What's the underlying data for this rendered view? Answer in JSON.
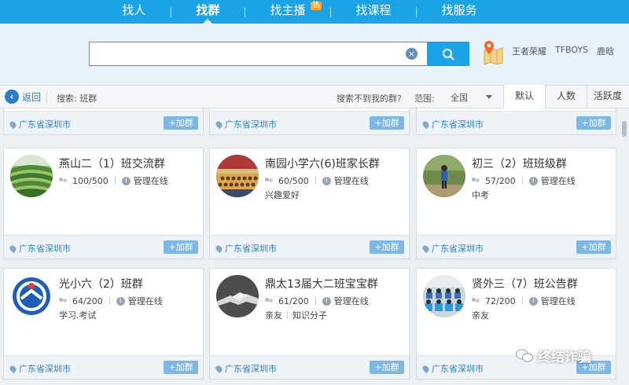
{
  "topnav": {
    "tabs": [
      {
        "label": "找人"
      },
      {
        "label": "找群"
      },
      {
        "label": "找主播",
        "badge": "热"
      },
      {
        "label": "找课程"
      },
      {
        "label": "找服务"
      }
    ],
    "active_index": 1,
    "separator": "|",
    "color": "#1aa3e6"
  },
  "search": {
    "query": "",
    "clear_symbol": "×",
    "hot_tags": [
      "王者荣耀",
      "TFBOYS",
      "鹿晗"
    ]
  },
  "toolbar": {
    "back_label": "返回",
    "search_label": "搜索: 班群",
    "not_found_label": "搜索不到我的群?",
    "range_label": "范围:",
    "range_value": "全国",
    "sort_tabs": [
      "默认",
      "人数",
      "活跃度"
    ],
    "active_sort_index": 0
  },
  "results": {
    "partial_row": [
      {
        "location": "广东省深圳市",
        "join_label": "+加群"
      },
      {
        "location": "广东省深圳市",
        "join_label": "+加群"
      },
      {
        "location": "广东省深圳市",
        "join_label": "+加群"
      }
    ],
    "cards": [
      {
        "name": "燕山二（1）班交流群",
        "members": "100/500",
        "admin_status": "管理在线",
        "tags": [],
        "location": "广东省深圳市",
        "join_label": "+加群",
        "avatar": "tea-field"
      },
      {
        "name": "南园小学六(6)班家长群",
        "members": "60/500",
        "admin_status": "管理在线",
        "tags": [
          "兴趣爱好"
        ],
        "location": "广东省深圳市",
        "join_label": "+加群",
        "avatar": "class-photo"
      },
      {
        "name": "初三（2）班班级群",
        "members": "57/200",
        "admin_status": "管理在线",
        "tags": [
          "中考"
        ],
        "location": "广东省深圳市",
        "join_label": "+加群",
        "avatar": "kid-outdoor"
      },
      {
        "name": "光小六（2）班群",
        "members": "64/200",
        "admin_status": "管理在线",
        "tags": [
          "学习.考试"
        ],
        "location": "广东省深圳市",
        "join_label": "+加群",
        "avatar": "school-logo"
      },
      {
        "name": "鼎太13届大二班宝宝群",
        "members": "61/200",
        "admin_status": "管理在线",
        "tags": [
          "亲友",
          "知识分子"
        ],
        "location": "广东省深圳市",
        "join_label": "+加群",
        "avatar": "handshake"
      },
      {
        "name": "贤外三（7）班公告群",
        "members": "72/200",
        "admin_status": "管理在线",
        "tags": [
          "亲友"
        ],
        "location": "广东省深圳市",
        "join_label": "+加群",
        "avatar": "classroom"
      }
    ]
  },
  "watermark": {
    "text": "终结诈骗"
  }
}
